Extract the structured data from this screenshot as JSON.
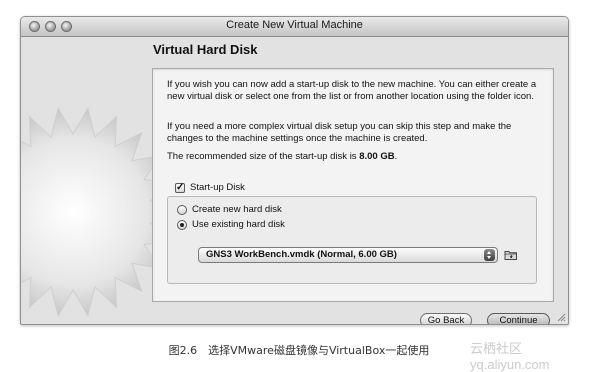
{
  "window": {
    "title": "Create New Virtual Machine"
  },
  "page": {
    "title": "Virtual Hard Disk"
  },
  "panel": {
    "paragraph_1": "If you wish you can now add a start-up disk to the new machine. You can either create a new virtual disk or select one from the list or from another location using the folder icon.",
    "paragraph_2": "If you need a more complex virtual disk setup you can skip this step and make the changes to the machine settings once the machine is created.",
    "recommended_prefix": "The recommended size of the start-up disk is",
    "recommended_value": "8.00 GB",
    "recommended_suffix": ".",
    "startup_disk_label": "Start-up Disk",
    "startup_disk_checked": true,
    "radio_create_label": "Create new hard disk",
    "radio_existing_label": "Use existing hard disk",
    "selected_radio": "existing",
    "disk_select_value": "GNS3 WorkBench.vmdk (Normal, 6.00 GB)",
    "folder_icon": "folder-icon"
  },
  "buttons": {
    "back_label": "Go Back",
    "continue_label": "Continue"
  },
  "caption": "图2.6　选择VMware磁盘镜像与VirtualBox一起使用",
  "watermark": "云栖社区 yq.aliyun.com"
}
